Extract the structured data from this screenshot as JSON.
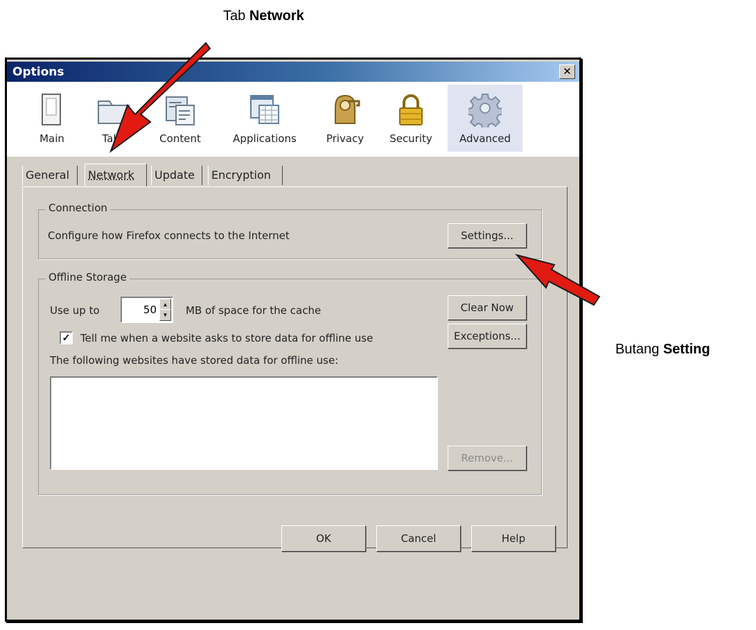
{
  "annotations": {
    "tab_caption_prefix": "Tab",
    "tab_caption_bold": "Network",
    "button_caption_prefix": "Butang",
    "button_caption_bold": "Setting"
  },
  "window": {
    "title": "Options",
    "close_label": "x"
  },
  "toolbar": {
    "panes": [
      {
        "label": "Main",
        "icon": "main-icon"
      },
      {
        "label": "Tabs",
        "icon": "tabs-icon"
      },
      {
        "label": "Content",
        "icon": "content-icon"
      },
      {
        "label": "Applications",
        "icon": "applications-icon"
      },
      {
        "label": "Privacy",
        "icon": "privacy-icon"
      },
      {
        "label": "Security",
        "icon": "security-icon"
      },
      {
        "label": "Advanced",
        "icon": "advanced-icon",
        "active": true
      }
    ]
  },
  "tabs": [
    "General",
    "Network",
    "Update",
    "Encryption"
  ],
  "connection": {
    "legend": "Connection",
    "description": "Configure how Firefox connects to the Internet",
    "settings_button": "Settings..."
  },
  "offline": {
    "legend": "Offline Storage",
    "use_up_to": "Use up to",
    "cache_value": "50",
    "cache_suffix": "MB of space for the cache",
    "clear_now": "Clear Now",
    "tell_me": "Tell me when a website asks to store data for offline use",
    "tell_me_checked": true,
    "exceptions": "Exceptions...",
    "list_label": "The following websites have stored data for offline use:",
    "remove": "Remove..."
  },
  "footer": {
    "ok": "OK",
    "cancel": "Cancel",
    "help": "Help"
  },
  "colors": {
    "arrow": "#e11a12",
    "titlebar": "#0a246a",
    "dialog": "#d4d0c8"
  }
}
